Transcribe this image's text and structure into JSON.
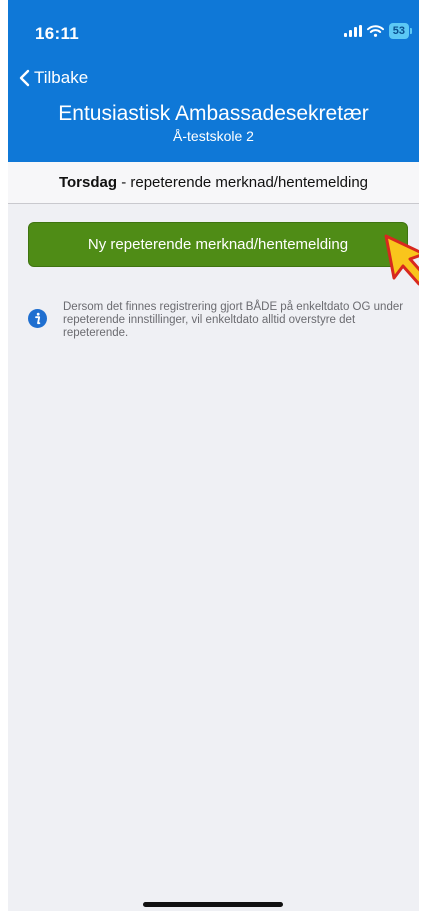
{
  "status_bar": {
    "time": "16:11",
    "battery": "53"
  },
  "nav": {
    "back_label": "Tilbake",
    "title": "Entusiastisk Ambassadesekretær",
    "subtitle": "Å-testskole 2"
  },
  "day_bar": {
    "day": "Torsdag",
    "rest": " - repeterende merknad/hentemelding"
  },
  "new_button_label": "Ny repeterende merknad/hentemelding",
  "info_text": "Dersom det finnes registrering gjort BÅDE på enkeltdato OG under repeterende innstillinger, vil enkeltdato alltid overstyre det repeterende.",
  "colors": {
    "header": "#0f78d7",
    "button": "#4f8c16",
    "background": "#eff0f4"
  },
  "icons": [
    "signal-icon",
    "wifi-icon",
    "battery-icon",
    "chevron-left-icon",
    "info-icon",
    "pointer-cursor-icon"
  ]
}
